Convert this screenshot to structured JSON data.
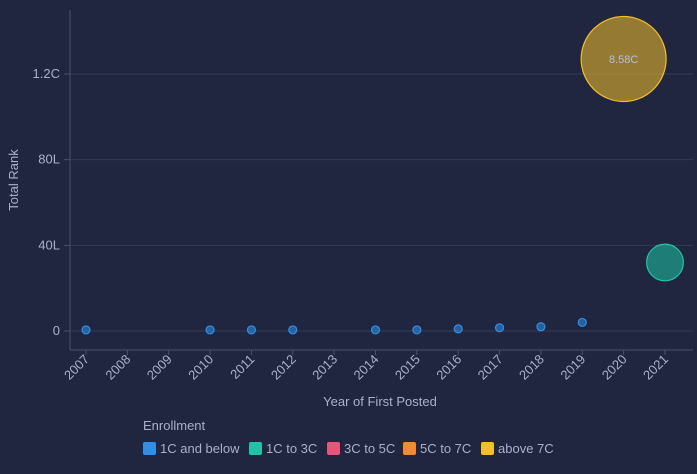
{
  "chart_data": {
    "type": "scatter",
    "xlabel": "Year of First Posted",
    "ylabel": "Total Rank",
    "categories": [
      "2007",
      "2008",
      "2009",
      "2010",
      "2011",
      "2012",
      "2013",
      "2014",
      "2015",
      "2016",
      "2017",
      "2018",
      "2019",
      "2020",
      "2021"
    ],
    "y_ticks": [
      {
        "value": 0,
        "label": "0"
      },
      {
        "value": 40,
        "label": "40L"
      },
      {
        "value": 80,
        "label": "80L"
      },
      {
        "value": 120,
        "label": "1.2C"
      }
    ],
    "ylim": [
      0,
      150
    ],
    "grid": true,
    "legend": {
      "title": "Enrollment",
      "position": "bottom",
      "items": [
        {
          "label": "1C and below",
          "color": "#2f8fe8"
        },
        {
          "label": "1C to 3C",
          "color": "#1fc4a6"
        },
        {
          "label": "3C to 5C",
          "color": "#e8557a"
        },
        {
          "label": "5C to 7C",
          "color": "#f08a35"
        },
        {
          "label": "above 7C",
          "color": "#f5bf2a"
        }
      ]
    },
    "points": [
      {
        "x": "2007",
        "y": 0.5,
        "enrollment": 2,
        "group": 0
      },
      {
        "x": "2010",
        "y": 0.5,
        "enrollment": 2,
        "group": 0
      },
      {
        "x": "2011",
        "y": 0.5,
        "enrollment": 2,
        "group": 0
      },
      {
        "x": "2012",
        "y": 0.5,
        "enrollment": 2,
        "group": 0
      },
      {
        "x": "2014",
        "y": 0.5,
        "enrollment": 2,
        "group": 0
      },
      {
        "x": "2015",
        "y": 0.5,
        "enrollment": 2,
        "group": 0
      },
      {
        "x": "2016",
        "y": 1,
        "enrollment": 4,
        "group": 0
      },
      {
        "x": "2017",
        "y": 1.5,
        "enrollment": 2,
        "group": 0
      },
      {
        "x": "2018",
        "y": 2,
        "enrollment": 2.5,
        "group": 0
      },
      {
        "x": "2019",
        "y": 4,
        "enrollment": 2,
        "group": 0
      },
      {
        "x": "2020",
        "y": 127,
        "enrollment": 858,
        "group": 4,
        "label": "8.58C"
      },
      {
        "x": "2021",
        "y": 32,
        "enrollment": 160,
        "group": 1
      }
    ]
  }
}
